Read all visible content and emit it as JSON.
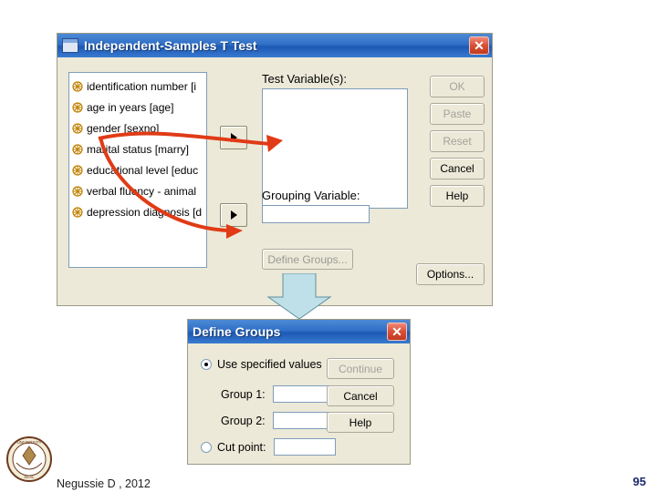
{
  "main_dialog": {
    "title": "Independent-Samples T Test",
    "close_label": "✕",
    "variables": [
      {
        "label": "identification number [i",
        "icon": "scale-variable-icon"
      },
      {
        "label": "age in years [age]",
        "icon": "scale-variable-icon"
      },
      {
        "label": "gender [sexno]",
        "icon": "scale-variable-icon"
      },
      {
        "label": "marital status [marry]",
        "icon": "scale-variable-icon"
      },
      {
        "label": "educational level [educ",
        "icon": "scale-variable-icon"
      },
      {
        "label": "verbal fluency - animal",
        "icon": "scale-variable-icon"
      },
      {
        "label": "depression diagnosis [d",
        "icon": "scale-variable-icon"
      }
    ],
    "test_variable_label": "Test Variable(s):",
    "test_variable_value": "",
    "grouping_variable_label": "Grouping Variable:",
    "grouping_variable_value": "",
    "move_test_button": "▶",
    "move_group_button": "▶",
    "define_groups_button": "Define Groups...",
    "buttons": [
      {
        "label": "OK",
        "enabled": false
      },
      {
        "label": "Paste",
        "enabled": false
      },
      {
        "label": "Reset",
        "enabled": false
      },
      {
        "label": "Cancel",
        "enabled": true
      },
      {
        "label": "Help",
        "enabled": true
      }
    ],
    "options_button": "Options..."
  },
  "define_groups_dialog": {
    "title": "Define Groups",
    "close_label": "✕",
    "use_specified_values_label": "Use specified values",
    "group1_label": "Group 1:",
    "group1_value": "",
    "group2_label": "Group 2:",
    "group2_value": "",
    "cut_point_label": "Cut point:",
    "cut_point_value": "",
    "buttons": [
      {
        "label": "Continue",
        "enabled": false
      },
      {
        "label": "Cancel",
        "enabled": true
      },
      {
        "label": "Help",
        "enabled": true
      }
    ]
  },
  "slide": {
    "footer": "Negussie D , 2012",
    "page_number": "95"
  },
  "colors": {
    "titlebar_blue": "#1c59b5",
    "dialog_face": "#ece9d8",
    "annotation_red": "#e03b16",
    "connector_teal": "#bfe0e8",
    "page_number": "#1a2a6c"
  }
}
